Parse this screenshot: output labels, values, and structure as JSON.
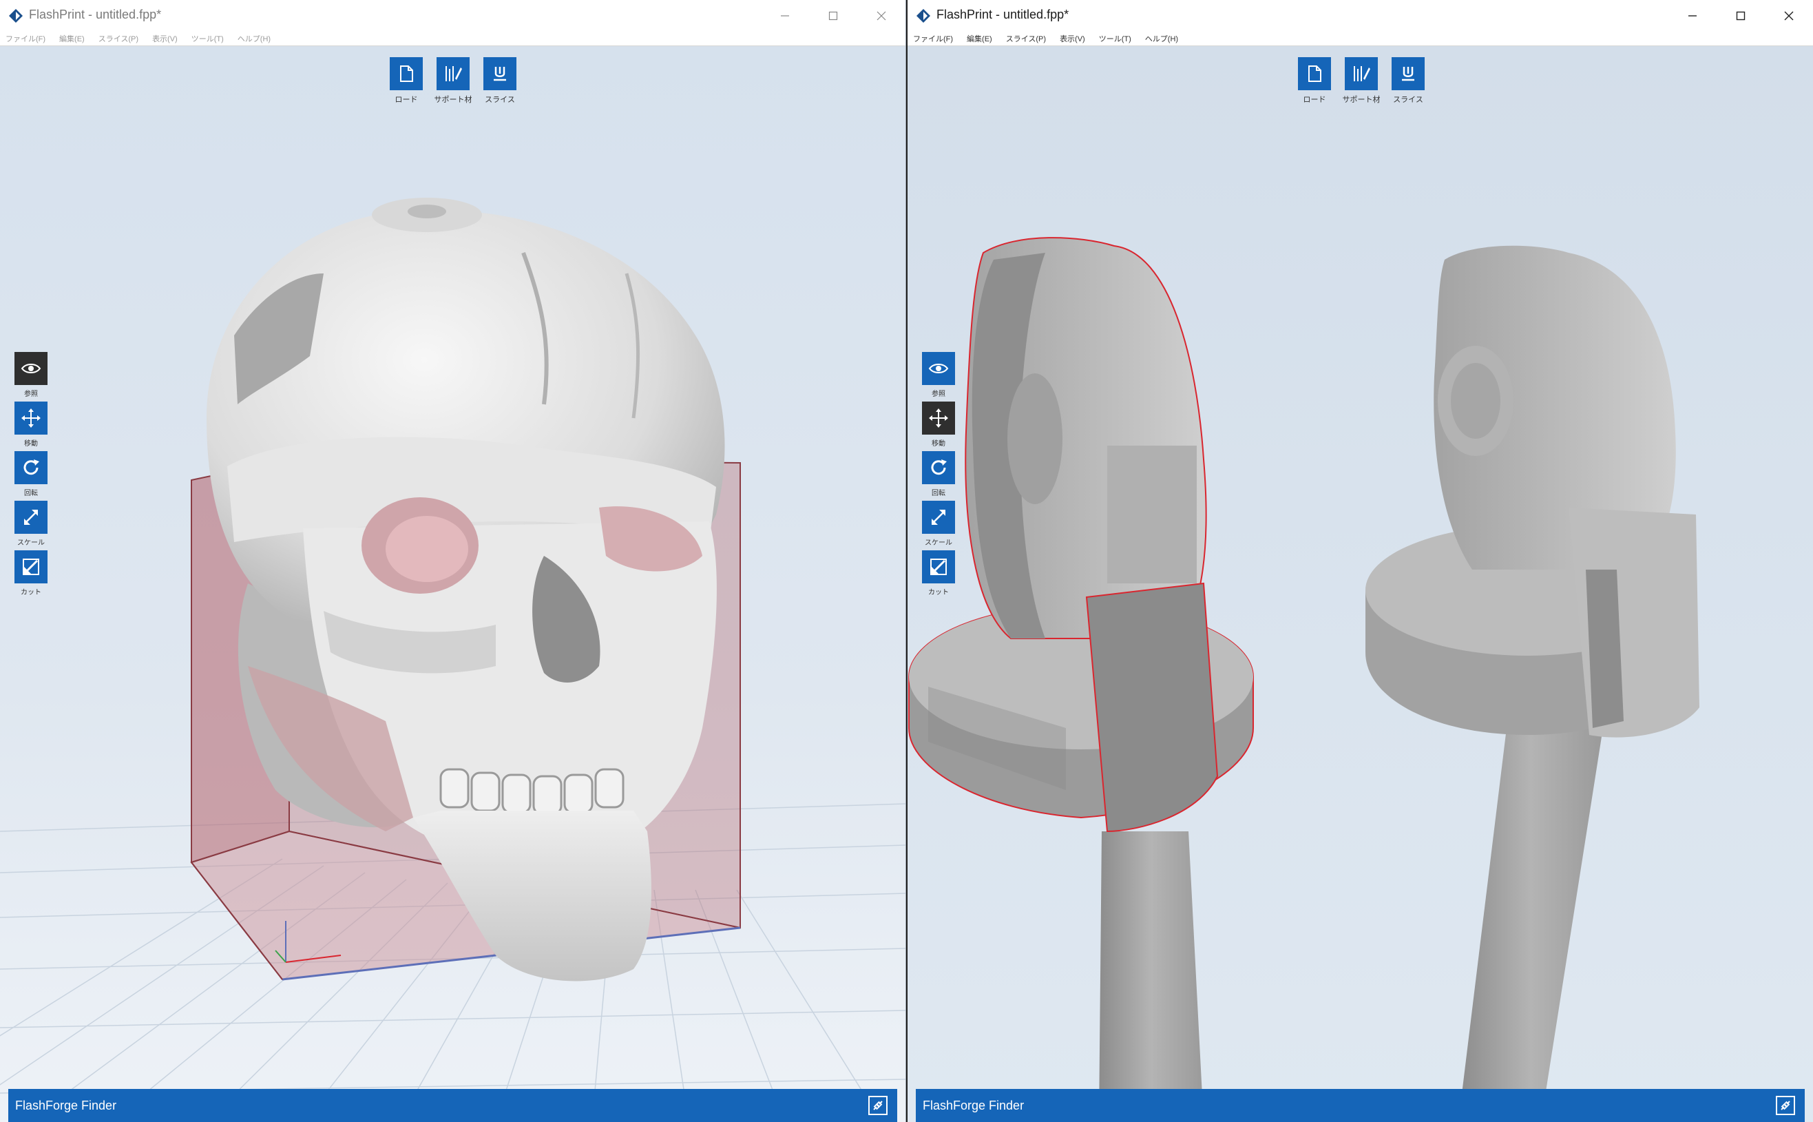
{
  "windows": [
    {
      "title": "FlashPrint - untitled.fpp*",
      "menu": [
        "ファイル(F)",
        "編集(E)",
        "スライス(P)",
        "表示(V)",
        "ツール(T)",
        "ヘルプ(H)"
      ],
      "top_tools": [
        {
          "label": "ロード",
          "icon": "load-file-icon"
        },
        {
          "label": "サポート材",
          "icon": "support-icon"
        },
        {
          "label": "スライス",
          "icon": "slice-icon"
        }
      ],
      "side_tools": [
        {
          "label": "参照",
          "icon": "eye-icon",
          "active": true
        },
        {
          "label": "移動",
          "icon": "move-icon",
          "active": false
        },
        {
          "label": "回転",
          "icon": "rotate-icon",
          "active": false
        },
        {
          "label": "スケール",
          "icon": "scale-icon",
          "active": false
        },
        {
          "label": "カット",
          "icon": "cut-icon",
          "active": false
        }
      ],
      "status": {
        "printer": "FlashForge Finder",
        "icon": "connect-link-icon"
      },
      "scene": {
        "model": "skull-model",
        "build_volume_color": "#b5636b"
      }
    },
    {
      "title": "FlashPrint - untitled.fpp*",
      "menu": [
        "ファイル(F)",
        "編集(E)",
        "スライス(P)",
        "表示(V)",
        "ツール(T)",
        "ヘルプ(H)"
      ],
      "top_tools": [
        {
          "label": "ロード",
          "icon": "load-file-icon"
        },
        {
          "label": "サポート材",
          "icon": "support-icon"
        },
        {
          "label": "スライス",
          "icon": "slice-icon"
        }
      ],
      "side_tools": [
        {
          "label": "参照",
          "icon": "eye-icon",
          "active": false
        },
        {
          "label": "移動",
          "icon": "move-icon",
          "active": true
        },
        {
          "label": "回転",
          "icon": "rotate-icon",
          "active": false
        },
        {
          "label": "スケール",
          "icon": "scale-icon",
          "active": false
        },
        {
          "label": "カット",
          "icon": "cut-icon",
          "active": false
        }
      ],
      "status": {
        "printer": "FlashForge Finder",
        "icon": "connect-link-icon"
      },
      "scene": {
        "model": "joint-model",
        "selection_outline_color": "#d9262f"
      }
    }
  ],
  "colors": {
    "accent": "#1565b8",
    "viewport_bg": "#d9e3ee",
    "active_tool": "#2f2f2f"
  }
}
